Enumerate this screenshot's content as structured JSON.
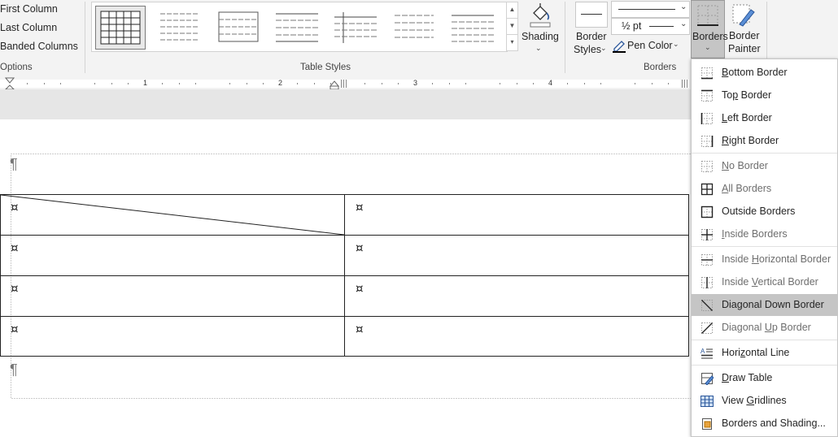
{
  "ribbon": {
    "options": [
      "First Column",
      "Last Column",
      "Banded Columns"
    ],
    "options_group_label": "Options",
    "table_styles_label": "Table Styles",
    "shading_label": "Shading",
    "border_styles_label": "Border Styles",
    "border_styles_line1": "Border",
    "border_styles_line2": "Styles",
    "pen_weight": "½ pt",
    "pen_color_label": "Pen Color",
    "borders_group_label": "Borders",
    "borders_button_label": "Borders",
    "border_painter_line1": "Border",
    "border_painter_line2": "Painter"
  },
  "ruler": {
    "numbers": [
      "1",
      "2",
      "3",
      "4"
    ]
  },
  "document": {
    "pilcrow": "¶",
    "cell_mark": "¤",
    "table": {
      "rows": 4,
      "cols": 2,
      "diagonal_down_cell": "row 1, column 1"
    }
  },
  "borders_menu": {
    "items": [
      {
        "label": "Bottom Border",
        "access": "B",
        "icon": "bottom-border-icon",
        "dim": false
      },
      {
        "label": "Top Border",
        "access": "p",
        "icon": "top-border-icon",
        "dim": false
      },
      {
        "label": "Left Border",
        "access": "L",
        "icon": "left-border-icon",
        "dim": false
      },
      {
        "label": "Right Border",
        "access": "R",
        "icon": "right-border-icon",
        "dim": false
      },
      {
        "label": "No Border",
        "access": "N",
        "icon": "no-border-icon",
        "dim": true
      },
      {
        "label": "All Borders",
        "access": "A",
        "icon": "all-borders-icon",
        "dim": true
      },
      {
        "label": "Outside Borders",
        "access": "S",
        "icon": "outside-borders-icon",
        "dim": false
      },
      {
        "label": "Inside Borders",
        "access": "I",
        "icon": "inside-borders-icon",
        "dim": true
      },
      {
        "label": "Inside Horizontal Border",
        "access": "H",
        "icon": "inside-horizontal-border-icon",
        "dim": true
      },
      {
        "label": "Inside Vertical Border",
        "access": "V",
        "icon": "inside-vertical-border-icon",
        "dim": true
      },
      {
        "label": "Diagonal Down Border",
        "access": "W",
        "icon": "diagonal-down-border-icon",
        "dim": false,
        "highlighted": true
      },
      {
        "label": "Diagonal Up Border",
        "access": "U",
        "icon": "diagonal-up-border-icon",
        "dim": true
      },
      {
        "label": "Horizontal Line",
        "access": "z",
        "icon": "horizontal-line-icon",
        "dim": false
      },
      {
        "label": "Draw Table",
        "access": "D",
        "icon": "draw-table-icon",
        "dim": false
      },
      {
        "label": "View Gridlines",
        "access": "G",
        "icon": "view-gridlines-icon",
        "dim": false
      },
      {
        "label": "Borders and Shading...",
        "access": "O",
        "icon": "borders-and-shading-icon",
        "dim": false
      }
    ]
  },
  "colors": {
    "accent": "#2b579a",
    "highlight": "#c5c5c5",
    "ribbon_bg": "#f3f3f3"
  }
}
